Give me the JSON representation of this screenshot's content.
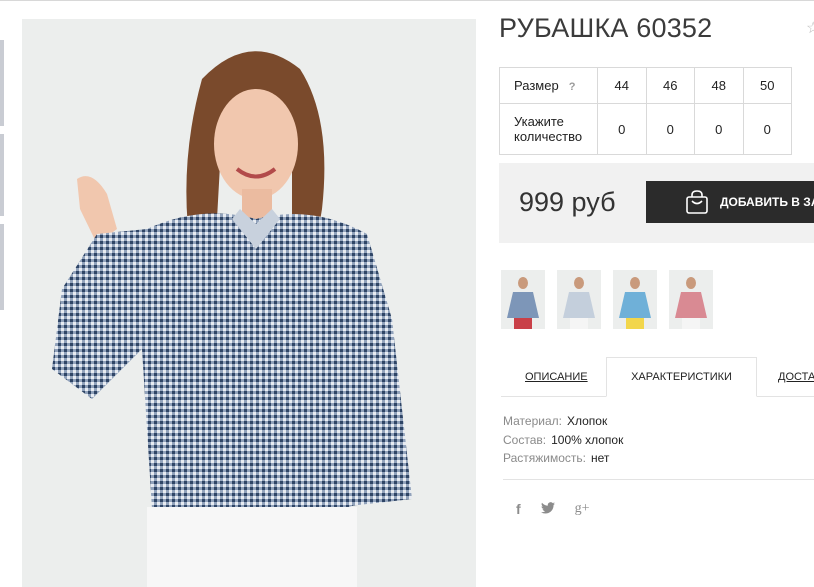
{
  "product": {
    "title": "РУБАШКА 60352"
  },
  "sizes": {
    "header_label": "Размер",
    "help_symbol": "?",
    "values": [
      "44",
      "46",
      "48",
      "50"
    ],
    "quantity_label": "Укажите количество",
    "quantities": [
      "0",
      "0",
      "0",
      "0"
    ]
  },
  "purchase": {
    "price": "999 руб",
    "cart_label": "ДОБАВИТЬ В ЗАКАЗ"
  },
  "colors": [
    "#7d96b8",
    "#c4cfdc",
    "#6fb0d8",
    "#d98a93"
  ],
  "tabs": {
    "description": "ОПИСАНИЕ",
    "characteristics": "ХАРАКТЕРИСТИКИ",
    "delivery": "ДОСТАВКА"
  },
  "specs": [
    {
      "key": "Материал:",
      "value": "Хлопок"
    },
    {
      "key": "Состав:",
      "value": "100% хлопок"
    },
    {
      "key": "Растяжимость:",
      "value": "нет"
    }
  ],
  "social": [
    "f",
    "t",
    "g+"
  ]
}
